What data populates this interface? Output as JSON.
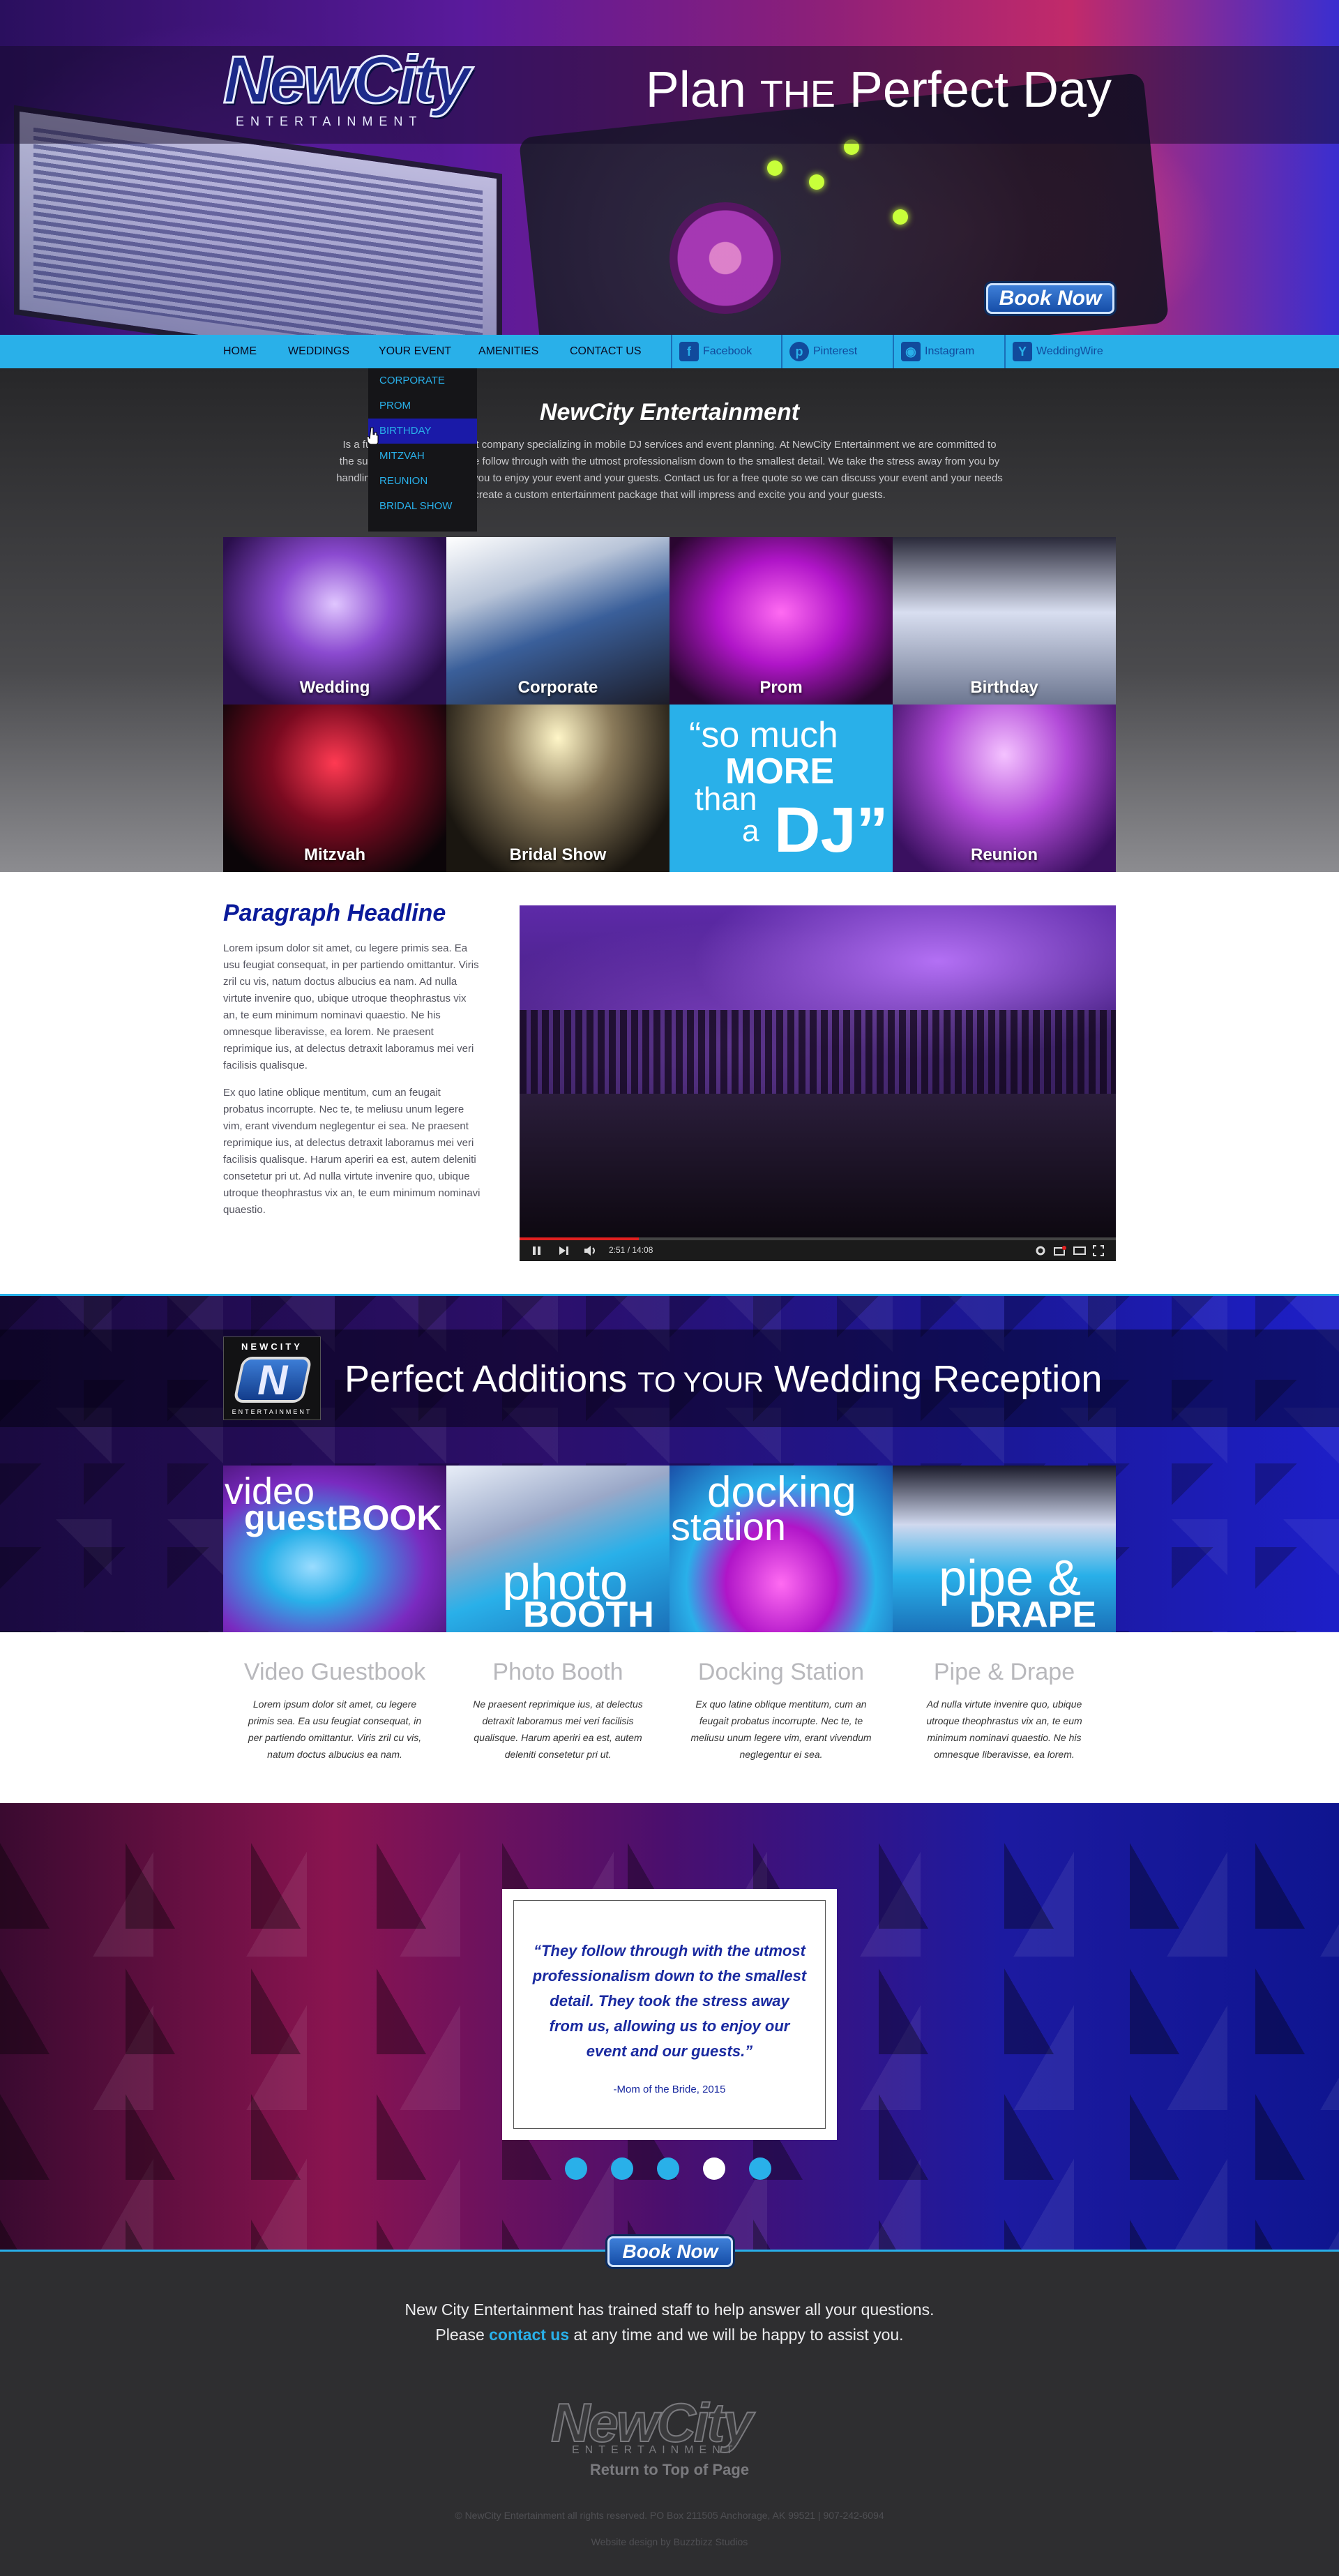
{
  "colors": {
    "accent": "#29b0e9",
    "brand_blue": "#1a2aa0",
    "nav_bg": "#29b0e9",
    "footer_bg": "#2e2e30"
  },
  "brand": {
    "logo_word": "NewCity",
    "logo_sub": "ENTERTAINMENT"
  },
  "hero": {
    "title_a": "Plan ",
    "title_caps": "THE",
    "title_b": " Perfect Day",
    "book_label": "Book Now"
  },
  "nav": {
    "items": [
      "HOME",
      "WEDDINGS",
      "YOUR EVENT",
      "AMENITIES",
      "CONTACT US"
    ],
    "social": [
      {
        "label": "Facebook",
        "icon": "facebook-icon"
      },
      {
        "label": "Pinterest",
        "icon": "pinterest-icon"
      },
      {
        "label": "Instagram",
        "icon": "instagram-icon"
      },
      {
        "label": "WeddingWire",
        "icon": "weddingwire-icon"
      }
    ],
    "dropdown": [
      "CORPORATE",
      "PROM",
      "BIRTHDAY",
      "MITZVAH",
      "REUNION",
      "BRIDAL SHOW"
    ],
    "dropdown_active": "BIRTHDAY"
  },
  "intro": {
    "title": "NewCity Entertainment",
    "text": "Is a full service entertainment company specializing in mobile DJ services and event planning. At NewCity Entertainment we are committed to the success of your event. We follow through with the utmost professionalism down to the smallest detail. We take the stress away from you by handling the details, allowing you to enjoy your event and your guests. Contact us for a free quote so we can discuss your event and your needs and create a custom entertainment package that will impress and excite you and your guests."
  },
  "tiles": [
    "Wedding",
    "Corporate",
    "Prom",
    "Birthday",
    "Mitzvah",
    "Bridal Show",
    "Reunion"
  ],
  "quote_tile": {
    "l1": "“so much",
    "l2": "MORE",
    "l3": "than",
    "l4": "a",
    "l5": "DJ”"
  },
  "paragraph": {
    "headline": "Paragraph Headline",
    "p1": "Lorem ipsum dolor sit amet, cu legere primis sea. Ea usu feugiat consequat, in per partiendo omittantur. Viris zril cu vis, natum doctus albucius ea nam. Ad nulla virtute invenire quo, ubique utroque theophrastus vix an, te eum minimum nominavi quaestio. Ne his omnesque liberavisse, ea lorem. Ne praesent reprimique ius, at delectus detraxit laboramus mei veri facilisis qualisque.",
    "p2": "Ex quo latine oblique mentitum, cum an feugait probatus incorrupte. Nec te, te meliusu unum legere vim, erant vivendum neglegentur ei sea. Ne praesent reprimique ius, at delectus detraxit laboramus mei veri facilisis qualisque. Harum aperiri ea est, autem deleniti consetetur pri ut. Ad nulla virtute invenire quo, ubique utroque theophrastus vix an, te eum minimum nominavi quaestio."
  },
  "video": {
    "time": "2:51 / 14:08",
    "progress": 0.2
  },
  "additions": {
    "badge_top": "NEWCITY",
    "badge_letter": "N",
    "badge_bot": "ENTERTAINMENT",
    "title_a": "Perfect Additions ",
    "title_caps": "TO YOUR",
    "title_b": " Wedding Reception",
    "tiles": [
      {
        "w1": "video",
        "w2": "guestBOOK"
      },
      {
        "w1": "photo",
        "w2": "BOOTH"
      },
      {
        "w1": "docking",
        "w2": "station"
      },
      {
        "w1": "pipe &",
        "w2": "DRAPE"
      }
    ],
    "cols": [
      {
        "title": "Video Guestbook",
        "text": "Lorem ipsum dolor sit amet, cu legere primis sea. Ea usu feugiat consequat, in per partiendo omittantur. Viris zril cu vis, natum doctus albucius ea nam."
      },
      {
        "title": "Photo Booth",
        "text": "Ne praesent reprimique ius, at delectus detraxit laboramus mei veri facilisis qualisque. Harum aperiri ea est, autem deleniti consetetur pri ut."
      },
      {
        "title": "Docking Station",
        "text": "Ex quo latine oblique mentitum, cum an feugait probatus incorrupte. Nec te, te meliusu unum legere vim, erant vivendum neglegentur ei sea."
      },
      {
        "title": "Pipe & Drape",
        "text": "Ad nulla virtute invenire quo, ubique utroque theophrastus vix an, te eum minimum nominavi quaestio. Ne his omnesque liberavisse, ea lorem."
      }
    ]
  },
  "testimonial": {
    "quote": "“They follow through with the utmost professionalism down to the smallest detail. They took the stress away from us, allowing us to enjoy our event and our guests.”",
    "author": "-Mom of the Bride, 2015",
    "active_dot": 3
  },
  "footer": {
    "book_label": "Book Now",
    "line1": "New City Entertainment has trained staff to help answer all your questions.",
    "line2_a": "Please ",
    "line2_link": "contact us",
    "line2_b": " at any time and we will be happy to assist you.",
    "logo_word": "NewCity",
    "logo_sub": "ENTERTAINMENT",
    "top_link": "Return to Top of Page",
    "copyright": "© NewCity Entertainment all rights reserved. PO Box 211505 Anchorage, AK 99521 | 907-242-6094",
    "credit": "Website design by Buzzbizz Studios"
  }
}
